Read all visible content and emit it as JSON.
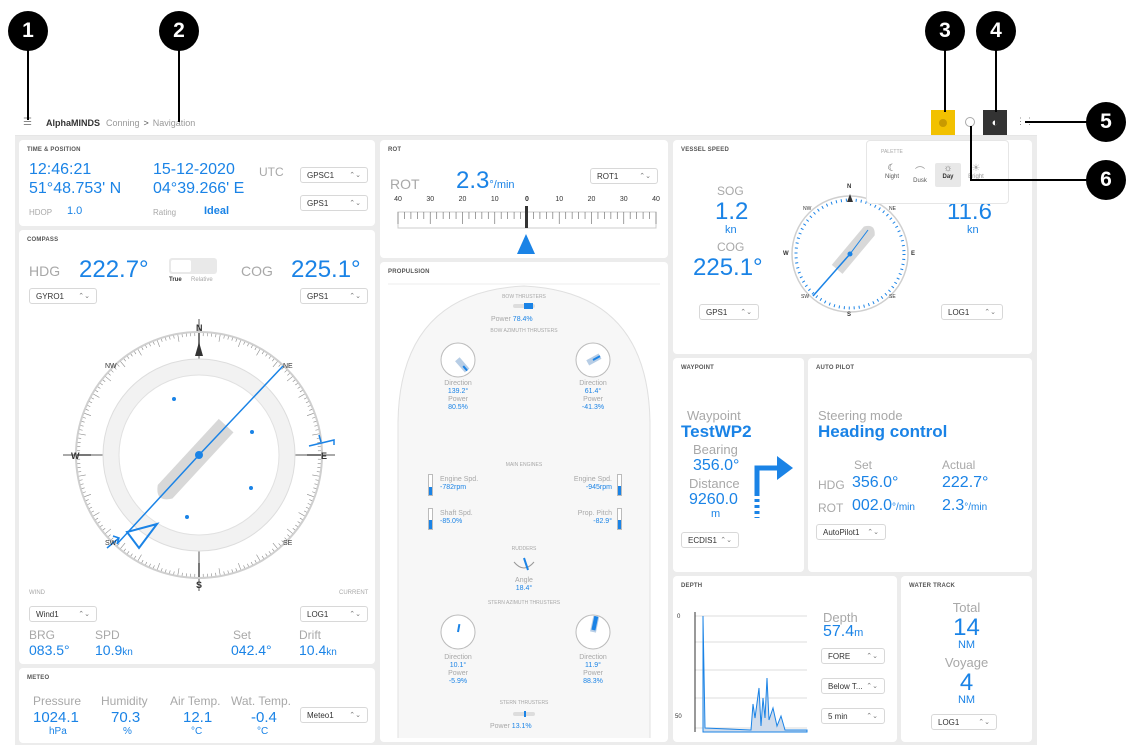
{
  "callouts": [
    "1",
    "2",
    "3",
    "4",
    "5",
    "6"
  ],
  "topbar": {
    "app_name": "AlphaMINDS",
    "crumb1": "Conning",
    "crumb_sep": ">",
    "crumb2": "Navigation"
  },
  "palette": {
    "title": "PALETTE",
    "options": [
      "Night",
      "Dusk",
      "Day",
      "Bright"
    ],
    "selected": "Day"
  },
  "time_position": {
    "title": "TIME & POSITION",
    "time": "12:46:21",
    "date": "15-12-2020",
    "utc": "UTC",
    "lat": "51°48.753' N",
    "lon": "04°39.266' E",
    "hdop_label": "HDOP",
    "hdop": "1.0",
    "rating_label": "Rating",
    "rating": "Ideal",
    "sel1": "GPSC1",
    "sel2": "GPS1"
  },
  "compass": {
    "title": "COMPASS",
    "hdg_label": "HDG",
    "hdg": "222.7°",
    "cog_label": "COG",
    "cog": "225.1°",
    "true_label": "True",
    "relative_label": "Relative",
    "sel_left": "GYRO1",
    "sel_right": "GPS1",
    "cardinals": {
      "n": "N",
      "s": "S",
      "e": "E",
      "w": "W",
      "ne": "NE",
      "nw": "NW",
      "se": "SE",
      "sw": "SW"
    },
    "wind_label": "WIND",
    "current_label": "CURRENT",
    "wind_sel": "Wind1",
    "current_sel": "LOG1",
    "brg_label": "BRG",
    "brg": "083.5°",
    "spd_label": "SPD",
    "spd": "10.9",
    "spd_unit": "kn",
    "set_label": "Set",
    "set": "042.4°",
    "drift_label": "Drift",
    "drift": "10.4",
    "drift_unit": "kn"
  },
  "meteo": {
    "title": "METEO",
    "pressure_label": "Pressure",
    "pressure": "1024.1",
    "pressure_unit": "hPa",
    "humidity_label": "Humidity",
    "humidity": "70.3",
    "humidity_unit": "%",
    "air_label": "Air Temp.",
    "air": "12.1",
    "air_unit": "°C",
    "wat_label": "Wat. Temp.",
    "wat": "-0.4",
    "wat_unit": "°C",
    "sel": "Meteo1"
  },
  "rot": {
    "title": "ROT",
    "label": "ROT",
    "value": "2.3",
    "unit": "°/min",
    "sel": "ROT1",
    "ticks": [
      "40",
      "30",
      "20",
      "10",
      "0",
      "10",
      "20",
      "30",
      "40"
    ]
  },
  "propulsion": {
    "title": "PROPULSION",
    "bow_thrusters": "BOW THRUSTERS",
    "bow_power_label": "Power",
    "bow_power": "78.4%",
    "bow_azimuth": "BOW AZIMUTH THRUSTERS",
    "bow_az_left": {
      "dir_label": "Direction",
      "dir": "139.2°",
      "pow_label": "Power",
      "pow": "80.5%"
    },
    "bow_az_right": {
      "dir_label": "Direction",
      "dir": "61.4°",
      "pow_label": "Power",
      "pow": "-41.3%"
    },
    "main_engines": "MAIN ENGINES",
    "eng_left_label": "Engine Spd.",
    "eng_left": "-782rpm",
    "eng_right_label": "Engine Spd.",
    "eng_right": "-945rpm",
    "shaft_label": "Shaft Spd.",
    "shaft": "-85.0%",
    "pitch_label": "Prop. Pitch",
    "pitch": "-82.9°",
    "rudders": "RUDDERS",
    "angle_label": "Angle",
    "angle": "18.4°",
    "stern_azimuth": "STERN AZIMUTH THRUSTERS",
    "stern_az_left": {
      "dir_label": "Direction",
      "dir": "10.1°",
      "pow_label": "Power",
      "pow": "-5.9%"
    },
    "stern_az_right": {
      "dir_label": "Direction",
      "dir": "11.9°",
      "pow_label": "Power",
      "pow": "88.3%"
    },
    "stern_thrusters": "STERN THRUSTERS",
    "stern_power_label": "Power",
    "stern_power": "13.1%"
  },
  "vessel_speed": {
    "title": "VESSEL SPEED",
    "sog_label": "SOG",
    "sog": "1.2",
    "sog_unit": "kn",
    "cog_label": "COG",
    "cog": "225.1°",
    "stw": "11.6",
    "stw_unit": "kn",
    "sel_left": "GPS1",
    "sel_right": "LOG1"
  },
  "waypoint": {
    "title": "WAYPOINT",
    "label": "Waypoint",
    "name": "TestWP2",
    "bearing_label": "Bearing",
    "bearing": "356.0°",
    "distance_label": "Distance",
    "distance": "9260.0",
    "distance_unit": "m",
    "sel": "ECDIS1"
  },
  "autopilot": {
    "title": "AUTO PILOT",
    "mode_label": "Steering mode",
    "mode": "Heading control",
    "set_label": "Set",
    "actual_label": "Actual",
    "hdg_label": "HDG",
    "hdg_set": "356.0°",
    "hdg_actual": "222.7°",
    "rot_label": "ROT",
    "rot_set": "002.0",
    "rot_actual": "2.3",
    "rot_unit": "°/min",
    "sel": "AutoPilot1"
  },
  "depth": {
    "title": "DEPTH",
    "label": "Depth",
    "value": "57.4",
    "unit": "m",
    "sel1": "FORE",
    "sel2": "Below T...",
    "sel3": "5 min",
    "axis_top": "0",
    "axis_bottom": "50"
  },
  "water_track": {
    "title": "WATER TRACK",
    "total_label": "Total",
    "total": "14",
    "total_unit": "NM",
    "voyage_label": "Voyage",
    "voyage": "4",
    "voyage_unit": "NM",
    "sel": "LOG1"
  },
  "colors": {
    "accent": "#1a83e6",
    "highlight": "#f2c100",
    "bg": "#ececec"
  }
}
